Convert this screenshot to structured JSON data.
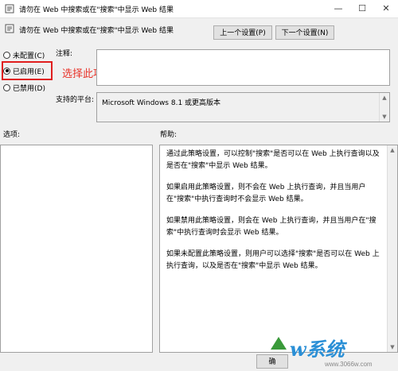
{
  "window": {
    "title": "请勿在 Web 中搜索或在\"搜索\"中显示 Web 结果",
    "minimize": "—",
    "maximize": "☐",
    "close": "✕"
  },
  "header": {
    "title": "请勿在 Web 中搜索或在\"搜索\"中显示 Web 结果"
  },
  "nav": {
    "prev_label": "上一个设置(P)",
    "next_label": "下一个设置(N)"
  },
  "options": {
    "not_configured": "未配置(C)",
    "enabled": "已启用(E)",
    "disabled": "已禁用(D)",
    "selected": "enabled"
  },
  "annotation": "选择此项",
  "comment": {
    "label": "注释:",
    "value": ""
  },
  "platform": {
    "label": "支持的平台:",
    "value": "Microsoft Windows 8.1 或更高版本"
  },
  "sections": {
    "options_label": "选项:",
    "help_label": "帮助:"
  },
  "help": {
    "p1": "通过此策略设置，可以控制\"搜索\"是否可以在 Web 上执行查询以及是否在\"搜索\"中显示 Web 结果。",
    "p2": "如果启用此策略设置，则不会在 Web 上执行查询，并且当用户在\"搜索\"中执行查询时不会显示 Web 结果。",
    "p3": "如果禁用此策略设置，则会在 Web 上执行查询，并且当用户在\"搜索\"中执行查询时会显示 Web 结果。",
    "p4": "如果未配置此策略设置，则用户可以选择\"搜索\"是否可以在 Web 上执行查询，以及是否在\"搜索\"中显示 Web 结果。"
  },
  "footer": {
    "ok_partial": "确"
  },
  "watermark": {
    "brand": "w系统",
    "url": "www.3066w.com"
  },
  "colors": {
    "annotation": "#e8342a",
    "highlight_box": "#e01e1e",
    "watermark": "#2a8fd6"
  }
}
